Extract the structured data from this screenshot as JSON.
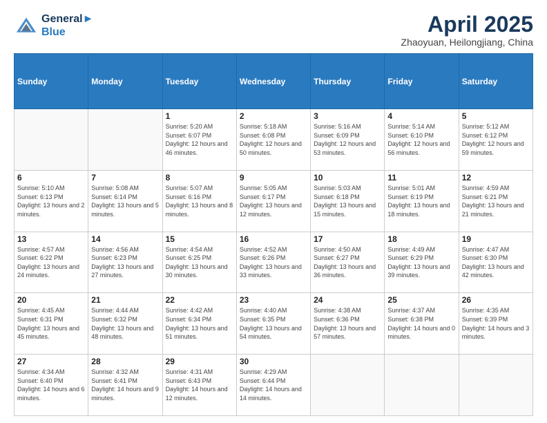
{
  "logo": {
    "line1": "General",
    "line2": "Blue"
  },
  "title": "April 2025",
  "location": "Zhaoyuan, Heilongjiang, China",
  "weekdays": [
    "Sunday",
    "Monday",
    "Tuesday",
    "Wednesday",
    "Thursday",
    "Friday",
    "Saturday"
  ],
  "weeks": [
    [
      {
        "day": "",
        "info": ""
      },
      {
        "day": "",
        "info": ""
      },
      {
        "day": "1",
        "info": "Sunrise: 5:20 AM\nSunset: 6:07 PM\nDaylight: 12 hours\nand 46 minutes."
      },
      {
        "day": "2",
        "info": "Sunrise: 5:18 AM\nSunset: 6:08 PM\nDaylight: 12 hours\nand 50 minutes."
      },
      {
        "day": "3",
        "info": "Sunrise: 5:16 AM\nSunset: 6:09 PM\nDaylight: 12 hours\nand 53 minutes."
      },
      {
        "day": "4",
        "info": "Sunrise: 5:14 AM\nSunset: 6:10 PM\nDaylight: 12 hours\nand 56 minutes."
      },
      {
        "day": "5",
        "info": "Sunrise: 5:12 AM\nSunset: 6:12 PM\nDaylight: 12 hours\nand 59 minutes."
      }
    ],
    [
      {
        "day": "6",
        "info": "Sunrise: 5:10 AM\nSunset: 6:13 PM\nDaylight: 13 hours\nand 2 minutes."
      },
      {
        "day": "7",
        "info": "Sunrise: 5:08 AM\nSunset: 6:14 PM\nDaylight: 13 hours\nand 5 minutes."
      },
      {
        "day": "8",
        "info": "Sunrise: 5:07 AM\nSunset: 6:16 PM\nDaylight: 13 hours\nand 8 minutes."
      },
      {
        "day": "9",
        "info": "Sunrise: 5:05 AM\nSunset: 6:17 PM\nDaylight: 13 hours\nand 12 minutes."
      },
      {
        "day": "10",
        "info": "Sunrise: 5:03 AM\nSunset: 6:18 PM\nDaylight: 13 hours\nand 15 minutes."
      },
      {
        "day": "11",
        "info": "Sunrise: 5:01 AM\nSunset: 6:19 PM\nDaylight: 13 hours\nand 18 minutes."
      },
      {
        "day": "12",
        "info": "Sunrise: 4:59 AM\nSunset: 6:21 PM\nDaylight: 13 hours\nand 21 minutes."
      }
    ],
    [
      {
        "day": "13",
        "info": "Sunrise: 4:57 AM\nSunset: 6:22 PM\nDaylight: 13 hours\nand 24 minutes."
      },
      {
        "day": "14",
        "info": "Sunrise: 4:56 AM\nSunset: 6:23 PM\nDaylight: 13 hours\nand 27 minutes."
      },
      {
        "day": "15",
        "info": "Sunrise: 4:54 AM\nSunset: 6:25 PM\nDaylight: 13 hours\nand 30 minutes."
      },
      {
        "day": "16",
        "info": "Sunrise: 4:52 AM\nSunset: 6:26 PM\nDaylight: 13 hours\nand 33 minutes."
      },
      {
        "day": "17",
        "info": "Sunrise: 4:50 AM\nSunset: 6:27 PM\nDaylight: 13 hours\nand 36 minutes."
      },
      {
        "day": "18",
        "info": "Sunrise: 4:49 AM\nSunset: 6:29 PM\nDaylight: 13 hours\nand 39 minutes."
      },
      {
        "day": "19",
        "info": "Sunrise: 4:47 AM\nSunset: 6:30 PM\nDaylight: 13 hours\nand 42 minutes."
      }
    ],
    [
      {
        "day": "20",
        "info": "Sunrise: 4:45 AM\nSunset: 6:31 PM\nDaylight: 13 hours\nand 45 minutes."
      },
      {
        "day": "21",
        "info": "Sunrise: 4:44 AM\nSunset: 6:32 PM\nDaylight: 13 hours\nand 48 minutes."
      },
      {
        "day": "22",
        "info": "Sunrise: 4:42 AM\nSunset: 6:34 PM\nDaylight: 13 hours\nand 51 minutes."
      },
      {
        "day": "23",
        "info": "Sunrise: 4:40 AM\nSunset: 6:35 PM\nDaylight: 13 hours\nand 54 minutes."
      },
      {
        "day": "24",
        "info": "Sunrise: 4:38 AM\nSunset: 6:36 PM\nDaylight: 13 hours\nand 57 minutes."
      },
      {
        "day": "25",
        "info": "Sunrise: 4:37 AM\nSunset: 6:38 PM\nDaylight: 14 hours\nand 0 minutes."
      },
      {
        "day": "26",
        "info": "Sunrise: 4:35 AM\nSunset: 6:39 PM\nDaylight: 14 hours\nand 3 minutes."
      }
    ],
    [
      {
        "day": "27",
        "info": "Sunrise: 4:34 AM\nSunset: 6:40 PM\nDaylight: 14 hours\nand 6 minutes."
      },
      {
        "day": "28",
        "info": "Sunrise: 4:32 AM\nSunset: 6:41 PM\nDaylight: 14 hours\nand 9 minutes."
      },
      {
        "day": "29",
        "info": "Sunrise: 4:31 AM\nSunset: 6:43 PM\nDaylight: 14 hours\nand 12 minutes."
      },
      {
        "day": "30",
        "info": "Sunrise: 4:29 AM\nSunset: 6:44 PM\nDaylight: 14 hours\nand 14 minutes."
      },
      {
        "day": "",
        "info": ""
      },
      {
        "day": "",
        "info": ""
      },
      {
        "day": "",
        "info": ""
      }
    ]
  ]
}
